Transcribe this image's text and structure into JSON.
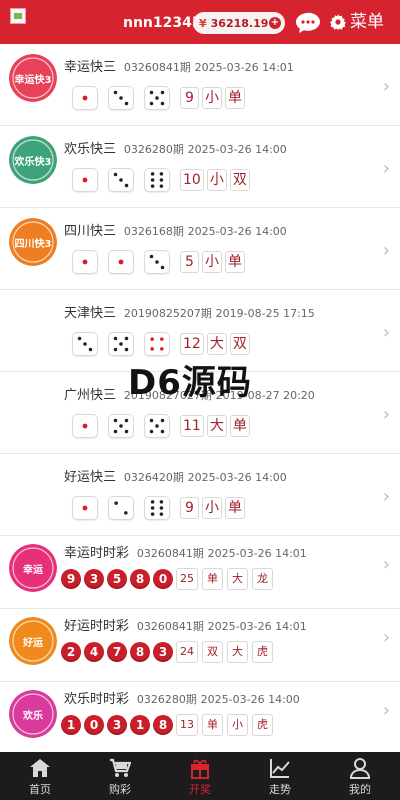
{
  "header": {
    "username": "nnn123456",
    "currency_symbol": "¥",
    "balance": "36218.19",
    "menu_label": "菜单"
  },
  "colors": {
    "brand_red": "#d5232f",
    "tabbar_bg": "#1c1c1c",
    "ball_red": "#c91f2b"
  },
  "watermark": "D6源码",
  "lotteries": [
    {
      "name": "幸运快三",
      "period": "03260841期",
      "time": "2025-03-26 14:01",
      "badge": "幸运快3",
      "dice": [
        1,
        3,
        5
      ],
      "results": [
        "9",
        "小",
        "单"
      ]
    },
    {
      "name": "欢乐快三",
      "period": "0326280期",
      "time": "2025-03-26 14:00",
      "badge": "欢乐快3",
      "dice": [
        1,
        3,
        6
      ],
      "results": [
        "10",
        "小",
        "双"
      ]
    },
    {
      "name": "四川快三",
      "period": "0326168期",
      "time": "2025-03-26 14:00",
      "badge": "四川快3",
      "dice": [
        1,
        1,
        3
      ],
      "results": [
        "5",
        "小",
        "单"
      ]
    },
    {
      "name": "天津快三",
      "period": "20190825207期",
      "time": "2019-08-25 17:15",
      "badge": "",
      "dice": [
        3,
        5,
        4
      ],
      "results": [
        "12",
        "大",
        "双"
      ]
    },
    {
      "name": "广州快三",
      "period": "20190827027期",
      "time": "2019-08-27 20:20",
      "badge": "",
      "dice": [
        1,
        5,
        5
      ],
      "results": [
        "11",
        "大",
        "单"
      ]
    },
    {
      "name": "好运快三",
      "period": "0326420期",
      "time": "2025-03-26 14:00",
      "badge": "",
      "dice": [
        1,
        2,
        6
      ],
      "results": [
        "9",
        "小",
        "单"
      ]
    }
  ],
  "ssc": [
    {
      "name": "幸运时时彩",
      "period": "03260841期",
      "time": "2025-03-26 14:01",
      "badge": "幸运时时彩",
      "balls": [
        "9",
        "3",
        "5",
        "8",
        "0"
      ],
      "tags": [
        "25",
        "单",
        "大",
        "龙"
      ]
    },
    {
      "name": "好运时时彩",
      "period": "03260841期",
      "time": "2025-03-26 14:01",
      "badge": "好运时时彩",
      "balls": [
        "2",
        "4",
        "7",
        "8",
        "3"
      ],
      "tags": [
        "24",
        "双",
        "大",
        "虎"
      ]
    },
    {
      "name": "欢乐时时彩",
      "period": "0326280期",
      "time": "2025-03-26 14:00",
      "badge": "欢乐时时彩",
      "balls": [
        "1",
        "0",
        "3",
        "1",
        "8"
      ],
      "tags": [
        "13",
        "单",
        "小",
        "虎"
      ]
    }
  ],
  "tabs": [
    {
      "label": "首页",
      "icon": "home-icon"
    },
    {
      "label": "购彩",
      "icon": "cart-icon"
    },
    {
      "label": "开奖",
      "icon": "gift-icon"
    },
    {
      "label": "走势",
      "icon": "trend-icon"
    },
    {
      "label": "我的",
      "icon": "user-icon"
    }
  ]
}
